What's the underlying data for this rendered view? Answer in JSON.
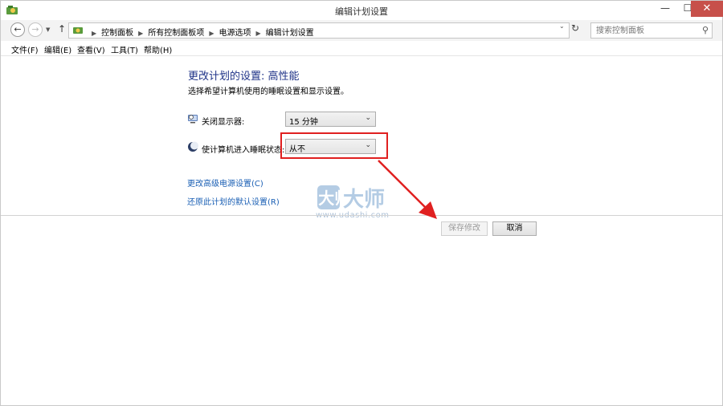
{
  "window": {
    "title": "编辑计划设置",
    "controls": {
      "minimize": "—",
      "maximize": "☐",
      "close": "✕"
    }
  },
  "address_bar": {
    "breadcrumbs": [
      "控制面板",
      "所有控制面板项",
      "电源选项",
      "编辑计划设置"
    ],
    "search_placeholder": "搜索控制面板"
  },
  "menu": [
    "文件(F)",
    "编辑(E)",
    "查看(V)",
    "工具(T)",
    "帮助(H)"
  ],
  "content": {
    "heading": "更改计划的设置: 高性能",
    "subtitle": "选择希望计算机使用的睡眠设置和显示设置。",
    "settings": [
      {
        "label": "关闭显示器:",
        "value": "15 分钟",
        "icon": "monitor-icon"
      },
      {
        "label": "使计算机进入睡眠状态:",
        "value": "从不",
        "icon": "sleep-moon-icon"
      }
    ],
    "links": [
      "更改高级电源设置(C)",
      "还原此计划的默认设置(R)"
    ],
    "buttons": {
      "save": "保存修改",
      "cancel": "取消"
    }
  },
  "watermark": {
    "text": "U大师",
    "url": "www.udashi.com"
  },
  "colors": {
    "heading": "#1e3287",
    "link": "#1a5fb4",
    "highlight": "#e02020",
    "close_button": "#c7504a"
  }
}
